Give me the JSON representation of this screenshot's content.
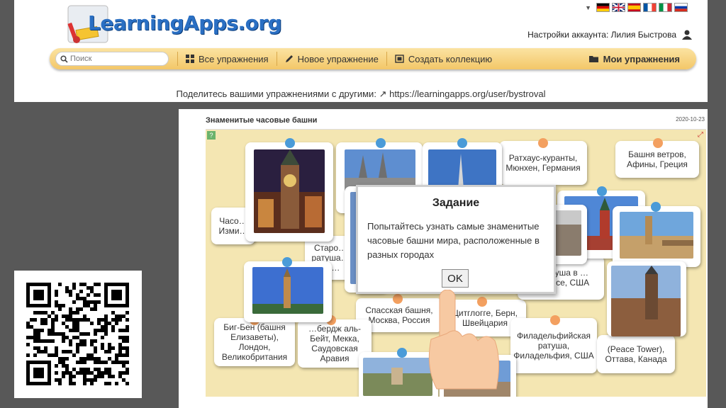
{
  "header": {
    "logo_text": "LearningApps.org",
    "account_label": "Настройки аккаунта: Лилия Быстрова",
    "share_text": "Поделитесь вашими упражнениями с другими:",
    "share_url": "https://learningapps.org/user/bystroval"
  },
  "languages": [
    "de",
    "en",
    "es",
    "fr",
    "it",
    "ru"
  ],
  "nav": {
    "search_placeholder": "Поиск",
    "all_exercises": "Все упражнения",
    "new_exercise": "Новое упражнение",
    "create_collection": "Создать коллекцию",
    "my_exercises": "Мои упражнения"
  },
  "panel": {
    "title": "Знаменитые часовые башни",
    "date": "2020-10-23"
  },
  "cards": {
    "rathaus": "Ратхаус-куранты, Мюнхен, Германия",
    "winds": "Башня ветров, Афины, Греция",
    "izm": "Часо… Изми…",
    "staro": "Старо… ратуша… Че…",
    "spasskaya": "Спасская башня, Москва, Россия",
    "zytglogge": "Цитглогге, Берн, Швейцария",
    "minneapolis": "…ратуша в …аполисе, США",
    "bigben": "Биг-Бен (башня Елизаветы), Лондон, Великобритания",
    "abraj": "…бердж аль-Бейт, Мекка, Саудовская Аравия",
    "philadelphia": "Филадельфийская ратуша, Филадельфия, США",
    "peace": "(Peace Tower), Оттава, Канада"
  },
  "dialog": {
    "title": "Задание",
    "text": "Попытайтесь узнать самые знаменитые часовые башни мира, расположенные в разных городах",
    "ok": "OK"
  },
  "colors": {
    "page_bg": "#585858",
    "nav_bar": "#f3c768",
    "game_bg": "#f4e6b2",
    "pin_blue": "#4a9bd8",
    "pin_orange": "#f3a060",
    "logo_blue": "#2a6fc3"
  }
}
